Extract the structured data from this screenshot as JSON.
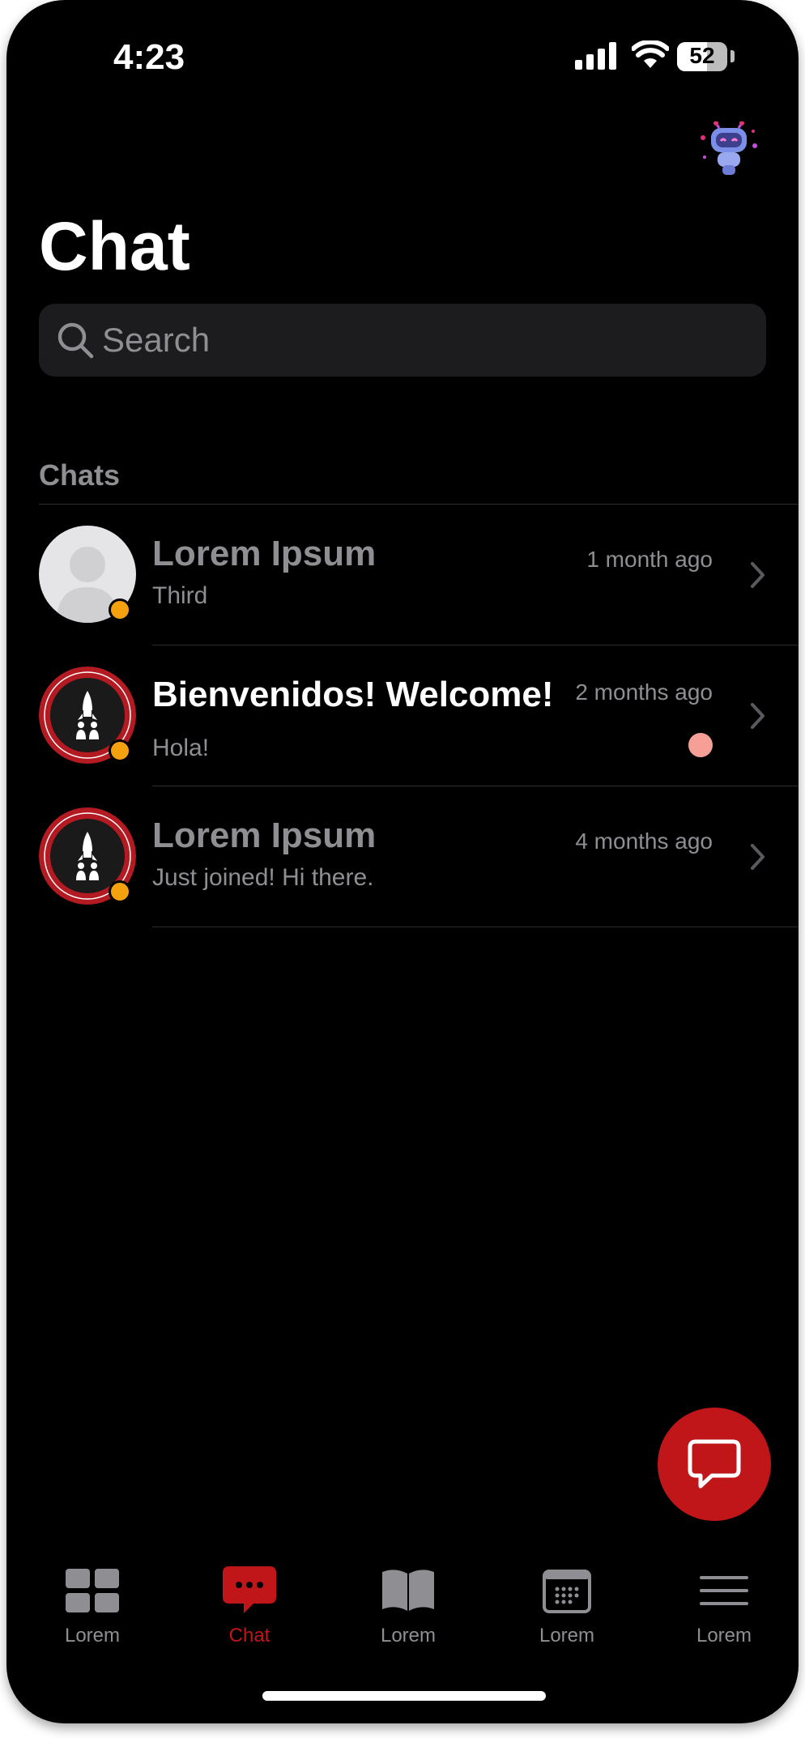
{
  "status_bar": {
    "time": "4:23",
    "battery": "52"
  },
  "header": {
    "title": "Chat"
  },
  "search": {
    "placeholder": "Search"
  },
  "section": {
    "label": "Chats"
  },
  "chats": [
    {
      "name": "Lorem Ipsum",
      "time": "1 month ago",
      "message": "Third",
      "unread": false
    },
    {
      "name": "Bienvenidos! Welcome!",
      "time": "2 months ago",
      "message": "Hola!",
      "unread": true
    },
    {
      "name": "Lorem Ipsum",
      "time": "4 months ago",
      "message": "Just joined! Hi there.",
      "unread": false
    }
  ],
  "tabs": [
    {
      "label": "Lorem",
      "icon": "grid-icon",
      "active": false
    },
    {
      "label": "Chat",
      "icon": "chat-bubble-icon",
      "active": true
    },
    {
      "label": "Lorem",
      "icon": "book-icon",
      "active": false
    },
    {
      "label": "Lorem",
      "icon": "calendar-icon",
      "active": false
    },
    {
      "label": "Lorem",
      "icon": "menu-icon",
      "active": false
    }
  ],
  "colors": {
    "background": "#000000",
    "accent": "#c0161a",
    "status_dot": "#f5a10f",
    "unread_dot": "#f59f96",
    "muted_text": "#8e8e93"
  }
}
